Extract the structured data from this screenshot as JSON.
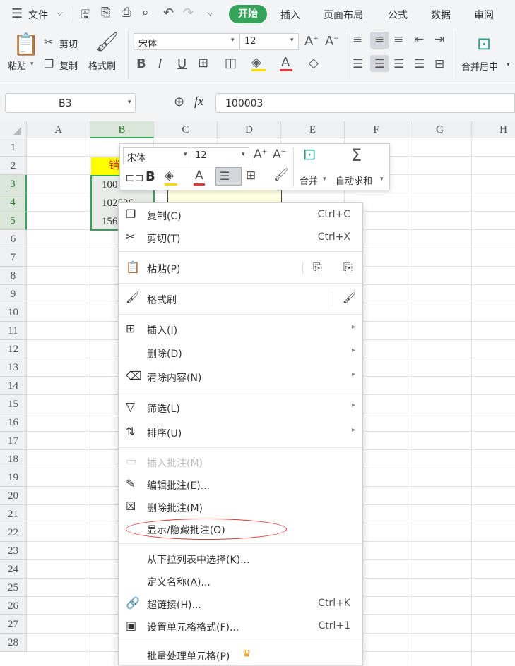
{
  "menubar": {
    "file_menu": "文件",
    "tabs": [
      "开始",
      "插入",
      "页面布局",
      "公式",
      "数据",
      "审阅"
    ]
  },
  "ribbon": {
    "paste": "粘贴",
    "cut": "剪切",
    "copy": "复制",
    "format_painter": "格式刷",
    "font_name": "宋体",
    "font_size": "12",
    "merge_center": "合并居中"
  },
  "formula_bar": {
    "cell_ref": "B3",
    "fx": "fx",
    "value": "100003"
  },
  "sheet": {
    "columns": [
      "A",
      "B",
      "C",
      "D",
      "E",
      "F",
      "G",
      "H"
    ],
    "rows": [
      "1",
      "2",
      "3",
      "4",
      "5",
      "6",
      "7",
      "8",
      "9",
      "10",
      "11",
      "12",
      "13",
      "14",
      "15",
      "16",
      "17",
      "18",
      "19",
      "20",
      "21",
      "22",
      "23",
      "24",
      "25",
      "26",
      "27",
      "28"
    ],
    "b2": "销",
    "b3": "100",
    "b4": "102536",
    "b5": "156"
  },
  "mini_toolbar": {
    "font_name": "宋体",
    "font_size": "12",
    "bold": "B",
    "merge": "合并",
    "autosum": "自动求和"
  },
  "context_menu": {
    "items": [
      {
        "label": "复制(C)",
        "shortcut": "Ctrl+C"
      },
      {
        "label": "剪切(T)",
        "shortcut": "Ctrl+X"
      },
      {
        "label": "粘贴(P)"
      },
      {
        "label": "格式刷"
      },
      {
        "label": "插入(I)"
      },
      {
        "label": "删除(D)"
      },
      {
        "label": "清除内容(N)"
      },
      {
        "label": "筛选(L)"
      },
      {
        "label": "排序(U)"
      },
      {
        "label": "插入批注(M)",
        "disabled": true
      },
      {
        "label": "编辑批注(E)..."
      },
      {
        "label": "删除批注(M)"
      },
      {
        "label": "显示/隐藏批注(O)"
      },
      {
        "label": "从下拉列表中选择(K)..."
      },
      {
        "label": "定义名称(A)..."
      },
      {
        "label": "超链接(H)...",
        "shortcut": "Ctrl+K"
      },
      {
        "label": "设置单元格格式(F)...",
        "shortcut": "Ctrl+1"
      },
      {
        "label": "批量处理单元格(P)"
      }
    ]
  },
  "colors": {
    "accent_green": "#35a35a",
    "highlight_yellow": "#ffff00",
    "comment_bg": "#ffffe1",
    "annotation_red": "#e53935"
  }
}
